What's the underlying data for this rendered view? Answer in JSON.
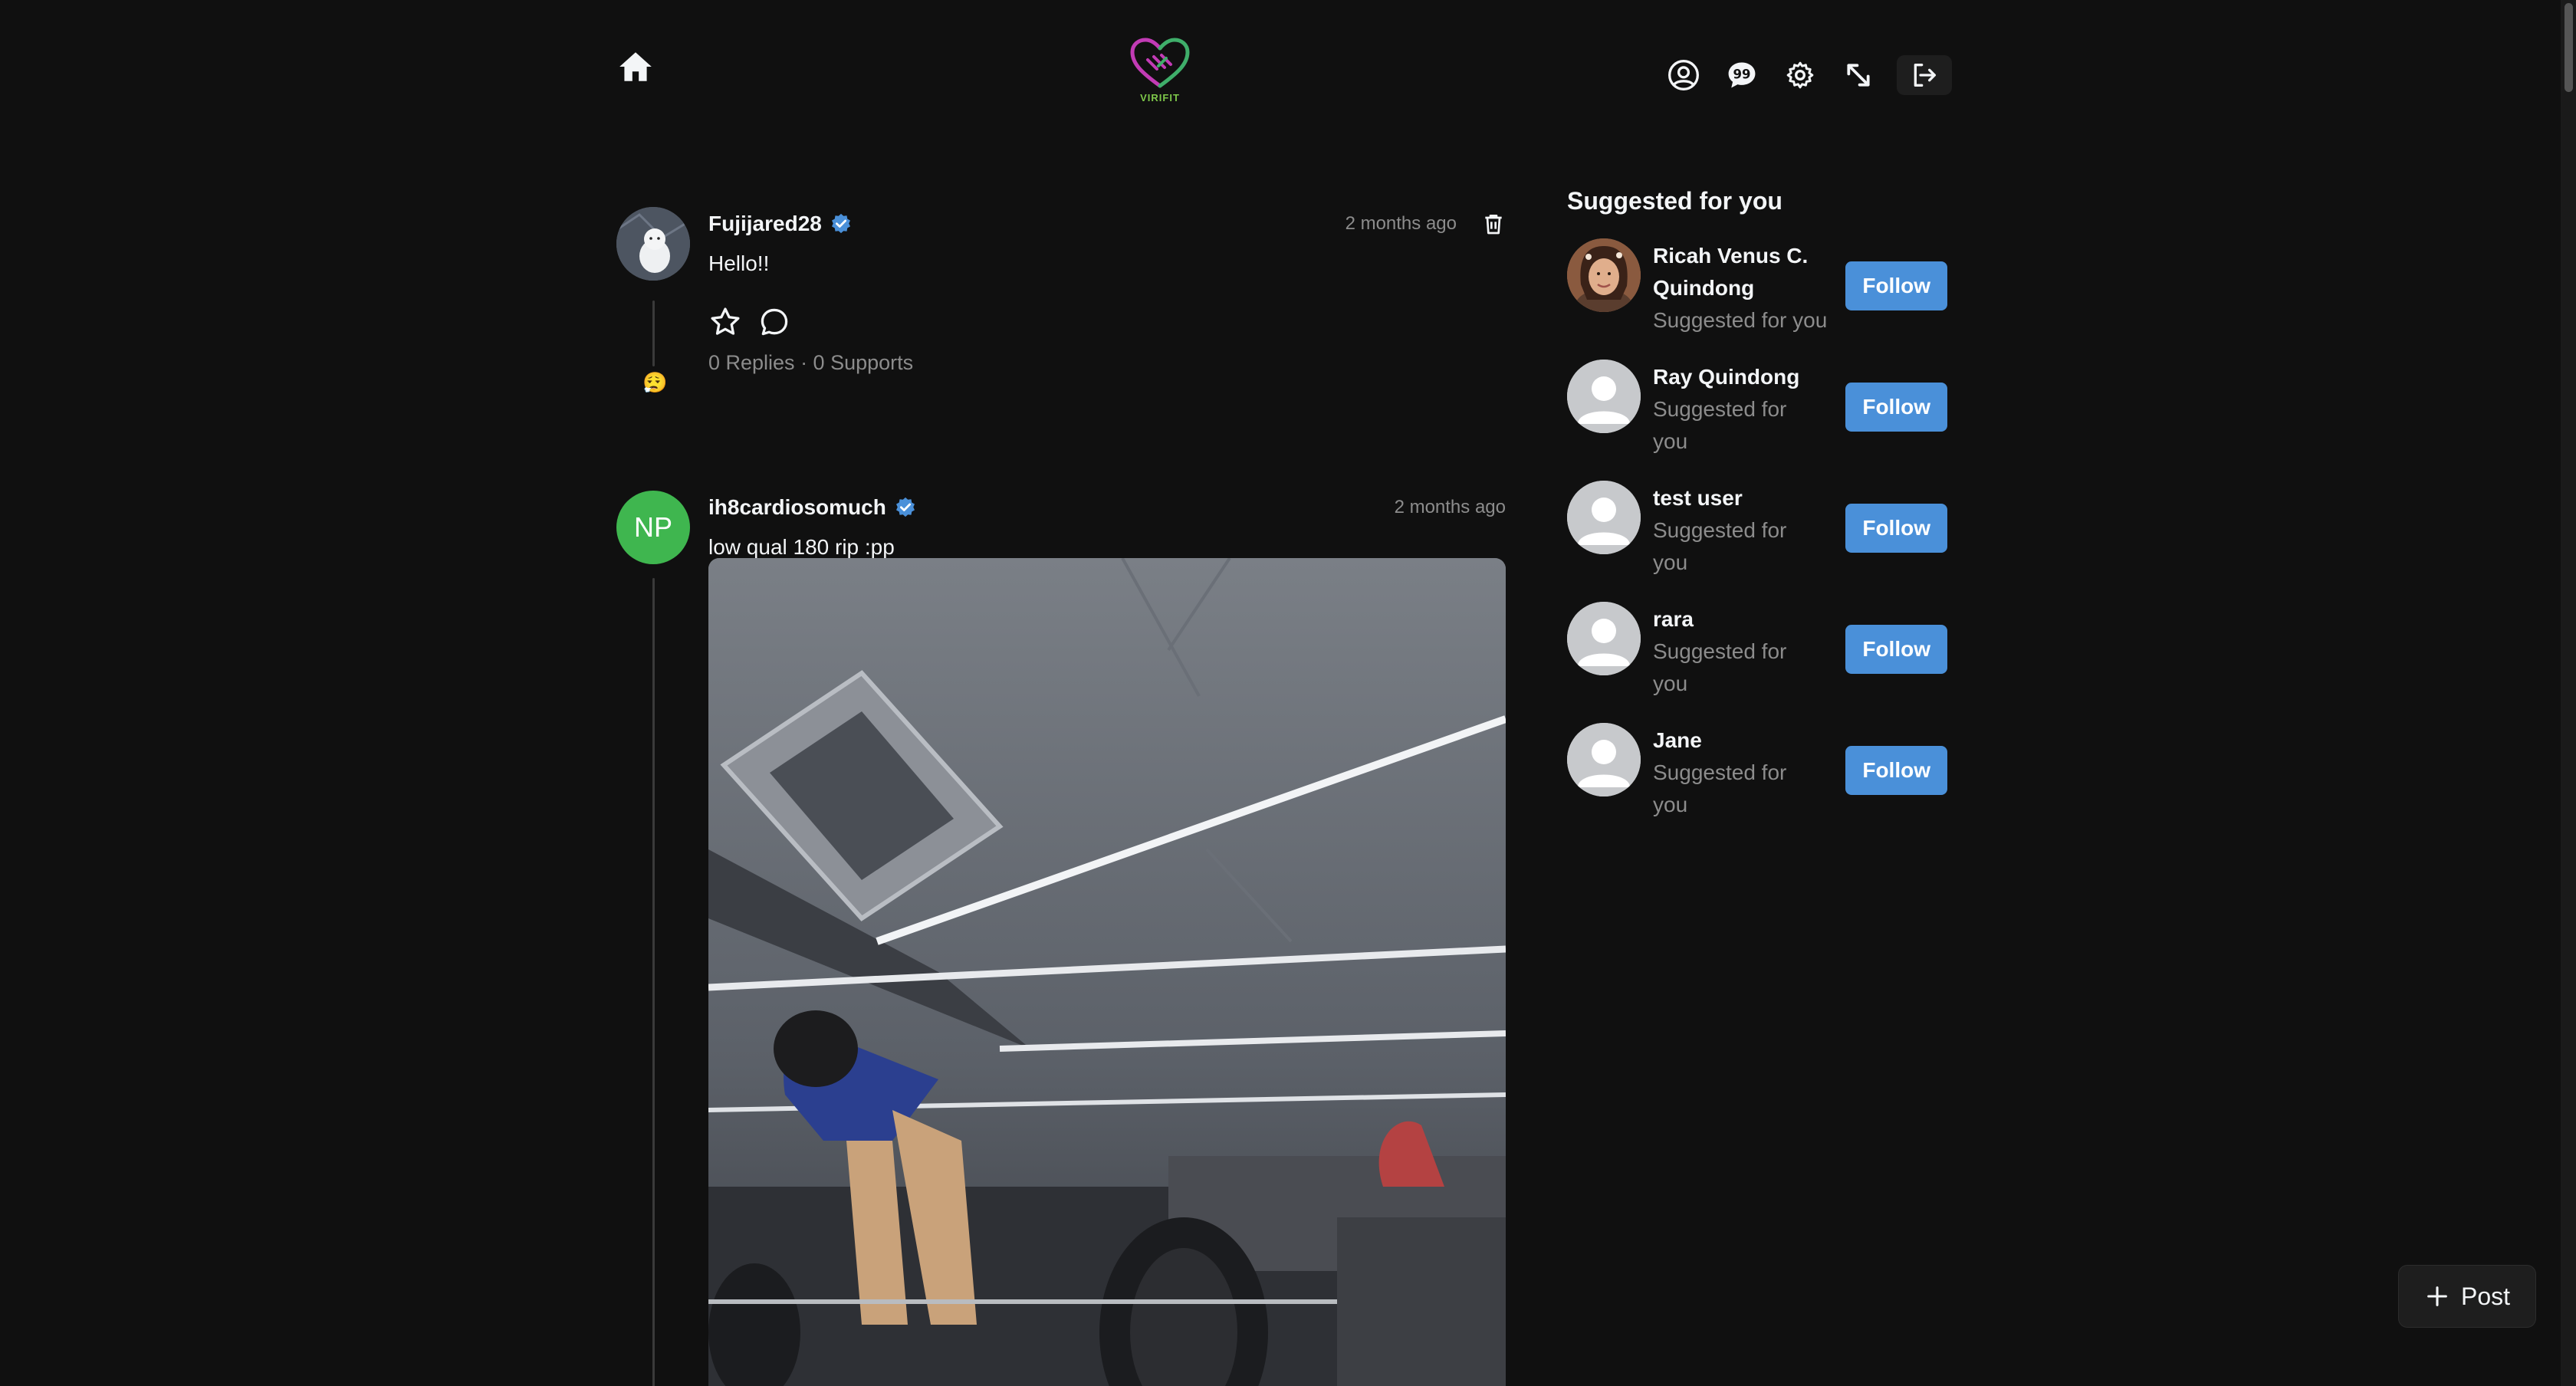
{
  "app": {
    "logo_text": "VIRIFIT",
    "colors": {
      "background": "#101010",
      "accent": "#4a90d9",
      "verified": "#4a90d9",
      "np_avatar": "#3fb64f"
    }
  },
  "nav": {
    "icons": [
      "home-icon",
      "profile-icon",
      "chat-icon",
      "settings-icon",
      "expand-icon",
      "logout-icon"
    ]
  },
  "posts": [
    {
      "username": "Fujijared28",
      "verified": true,
      "timestamp": "2 months ago",
      "text": "Hello!!",
      "stats": "0 Replies · 0 Supports",
      "reaction_emoji": "😮‍💨"
    },
    {
      "username": "ih8cardiosomuch",
      "avatar_initials": "NP",
      "verified": true,
      "timestamp": "2 months ago",
      "text": "low qual 180 rip :pp"
    }
  ],
  "sidebar": {
    "title": "Suggested for you",
    "items": [
      {
        "name": "Ricah Venus C. Quindong",
        "sub": "Suggested for you",
        "button": "Follow"
      },
      {
        "name": "Ray Quindong",
        "sub": "Suggested for you",
        "button": "Follow"
      },
      {
        "name": "test user",
        "sub": "Suggested for you",
        "button": "Follow"
      },
      {
        "name": "rara",
        "sub": "Suggested for you",
        "button": "Follow"
      },
      {
        "name": "Jane",
        "sub": "Suggested for you",
        "button": "Follow"
      }
    ]
  },
  "fab": {
    "label": "Post"
  }
}
